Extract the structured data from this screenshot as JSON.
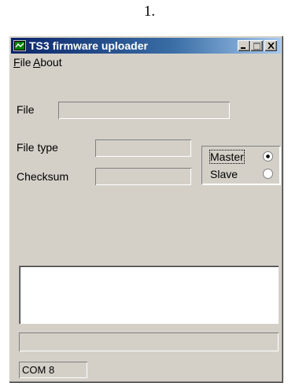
{
  "caption": "1.",
  "window": {
    "title": "TS3 firmware uploader",
    "icon": "app-window-icon",
    "controls": [
      "minimize-icon",
      "maximize-icon",
      "close-icon"
    ]
  },
  "menu": {
    "file": {
      "mnemonic": "F",
      "rest": "ile"
    },
    "about": {
      "mnemonic": "A",
      "rest": "bout"
    }
  },
  "form": {
    "file_label": "File",
    "file_value": "",
    "filetype_label": "File type",
    "filetype_value": "",
    "checksum_label": "Checksum",
    "checksum_value": ""
  },
  "mode": {
    "options": [
      {
        "label": "Master",
        "selected": true
      },
      {
        "label": "Slave",
        "selected": false
      }
    ]
  },
  "log": {
    "text": ""
  },
  "progress": {
    "fraction": 0
  },
  "status": {
    "port": "COM 8"
  },
  "colors": {
    "titlebar_start": "#0a246a",
    "titlebar_end": "#a6caf0",
    "face": "#d4d0c8"
  }
}
